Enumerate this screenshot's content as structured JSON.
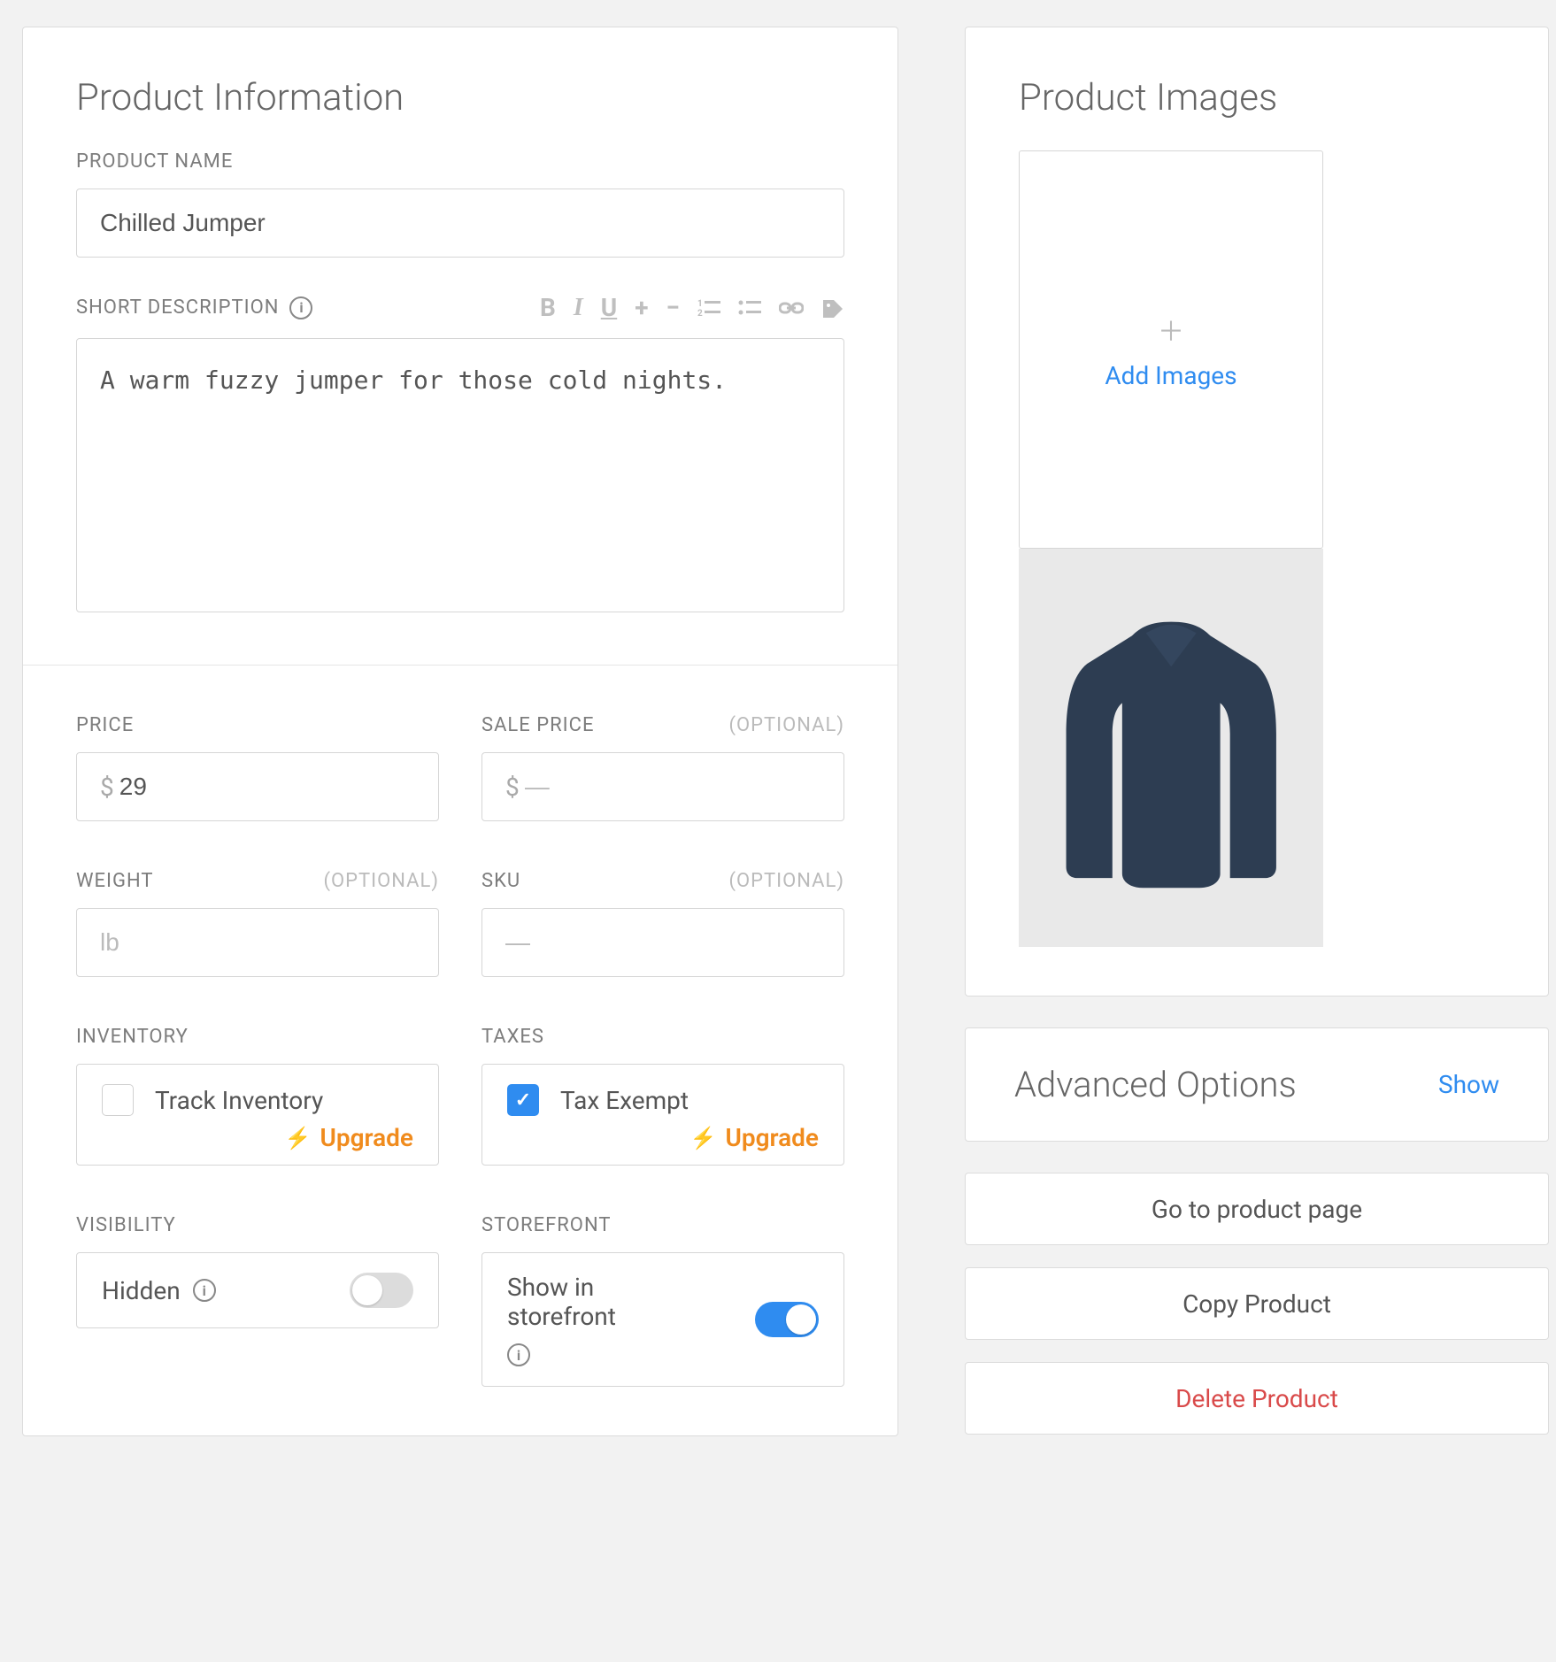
{
  "productInfo": {
    "title": "Product Information",
    "nameLabel": "PRODUCT NAME",
    "nameValue": "Chilled Jumper",
    "descLabel": "SHORT DESCRIPTION",
    "descValue": "A warm fuzzy jumper for those cold nights."
  },
  "pricing": {
    "priceLabel": "PRICE",
    "priceCurrency": "$",
    "priceValue": "29",
    "salePriceLabel": "SALE PRICE",
    "salePriceCurrency": "$",
    "salePricePlaceholder": "—",
    "weightLabel": "WEIGHT",
    "weightPlaceholder": "lb",
    "skuLabel": "SKU",
    "skuPlaceholder": "—",
    "optionalText": "(OPTIONAL)",
    "inventoryLabel": "INVENTORY",
    "trackInventoryLabel": "Track Inventory",
    "taxesLabel": "TAXES",
    "taxExemptLabel": "Tax Exempt",
    "upgradeLabel": "Upgrade",
    "visibilityLabel": "VISIBILITY",
    "hiddenLabel": "Hidden",
    "storefrontLabel": "STOREFRONT",
    "showInStorefrontLabel": "Show in storefront"
  },
  "images": {
    "title": "Product Images",
    "addLabel": "Add Images"
  },
  "advanced": {
    "title": "Advanced Options",
    "showLabel": "Show"
  },
  "actions": {
    "goToPage": "Go to product page",
    "copy": "Copy Product",
    "delete": "Delete Product"
  }
}
